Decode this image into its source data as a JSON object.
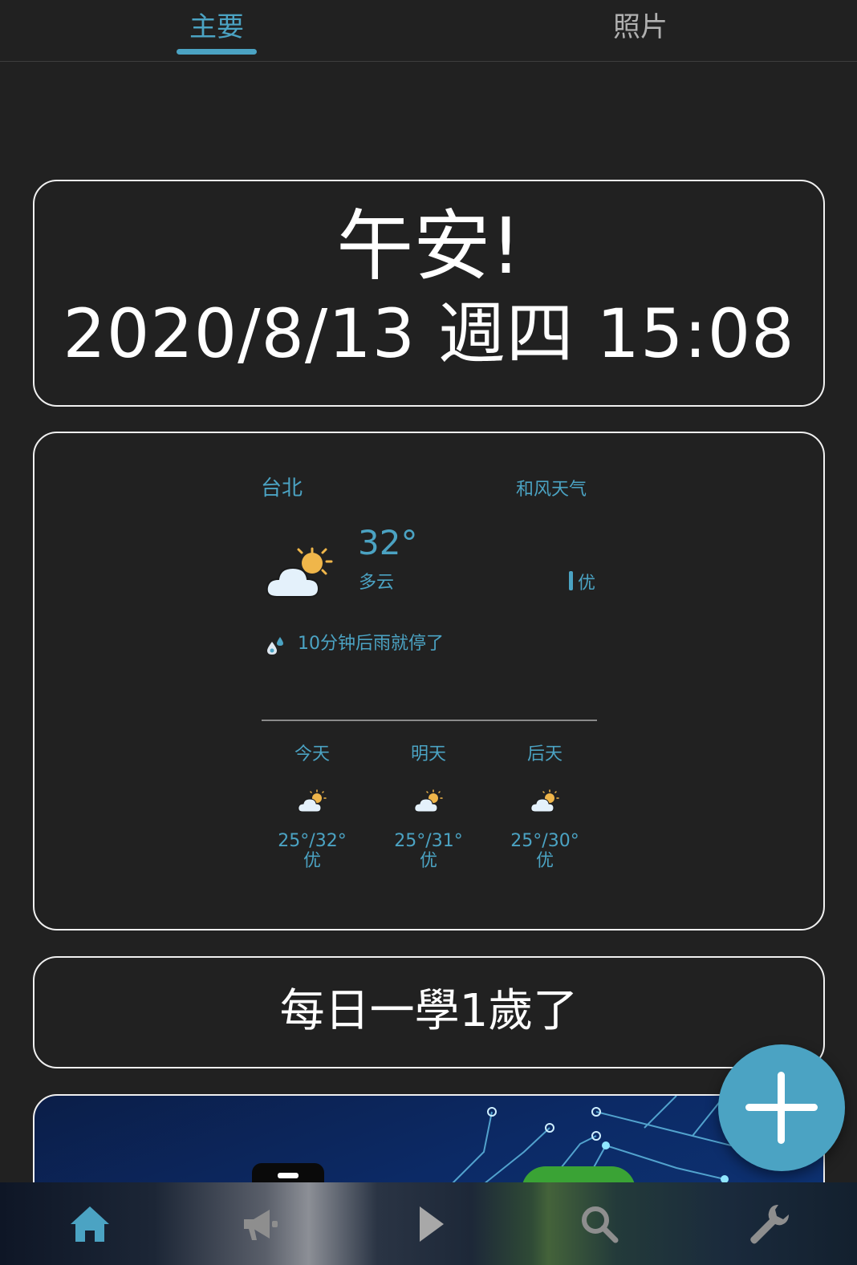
{
  "tabs": {
    "main_label": "主要",
    "photo_label": "照片",
    "active": "main",
    "accent_color": "#4ba3c3"
  },
  "greeting_card": {
    "greeting": "午安!",
    "datetime": "2020/8/13 週四 15:08"
  },
  "weather": {
    "city": "台北",
    "provider": "和风天气",
    "temperature": "32°",
    "condition": "多云",
    "condition_icon": "partly-cloudy-icon",
    "aqi": "优",
    "rain_forecast": "10分钟后雨就停了",
    "rain_icon": "raindrop-icon",
    "forecast": [
      {
        "day": "今天",
        "temp": "25°/32°",
        "aqi": "优",
        "icon": "partly-cloudy-icon"
      },
      {
        "day": "明天",
        "temp": "25°/31°",
        "aqi": "优",
        "icon": "partly-cloudy-icon"
      },
      {
        "day": "后天",
        "temp": "25°/30°",
        "aqi": "优",
        "icon": "partly-cloudy-icon"
      }
    ]
  },
  "study_card": {
    "text": "每日一學1歲了"
  },
  "fab": {
    "icon": "plus-icon",
    "color": "#4ba3c3"
  },
  "bottom_nav": {
    "items": [
      {
        "icon": "home-icon",
        "active": true
      },
      {
        "icon": "megaphone-icon",
        "active": false
      },
      {
        "icon": "play-icon",
        "active": false
      },
      {
        "icon": "search-icon",
        "active": false
      },
      {
        "icon": "wrench-icon",
        "active": false
      }
    ]
  }
}
